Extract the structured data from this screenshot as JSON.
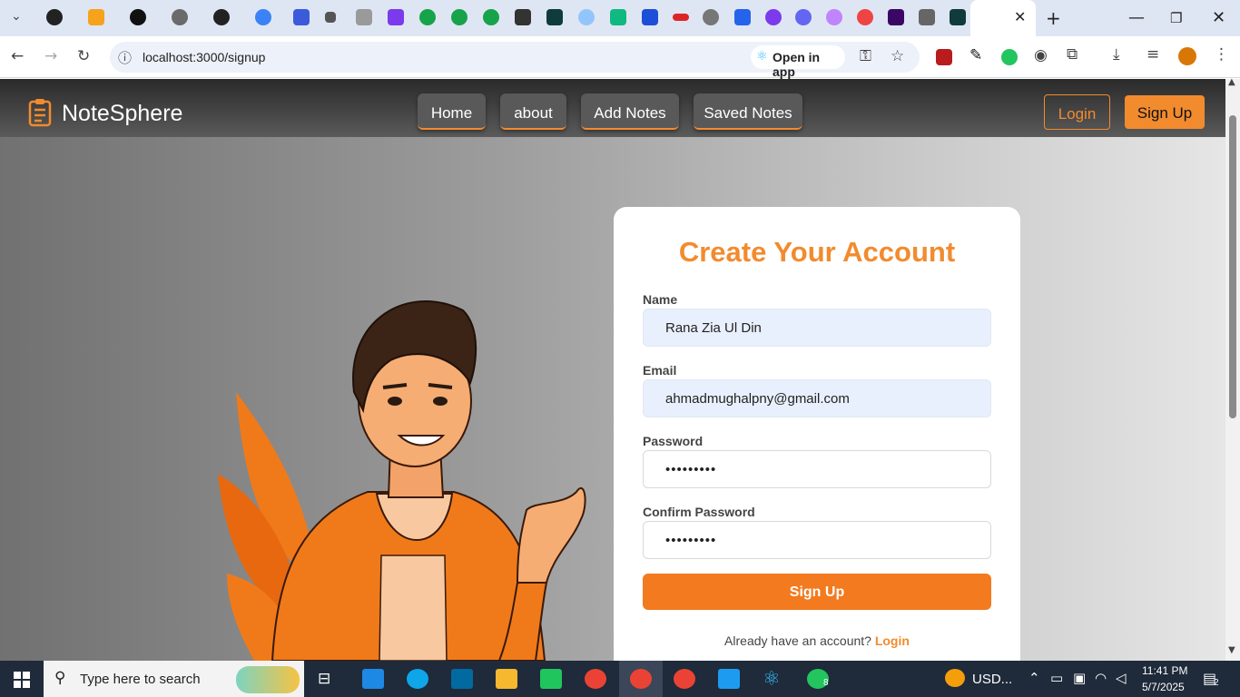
{
  "browser": {
    "url": "localhost:3000/signup",
    "open_in_app": "Open in app"
  },
  "nav": {
    "brand": "NoteSphere",
    "links": [
      "Home",
      "about",
      "Add Notes",
      "Saved Notes"
    ],
    "login": "Login",
    "signup": "Sign Up"
  },
  "form": {
    "title": "Create Your Account",
    "name_label": "Name",
    "name_value": "Rana Zia Ul Din",
    "email_label": "Email",
    "email_value": "ahmadmughalpny@gmail.com",
    "password_label": "Password",
    "password_value": "•••••••••",
    "confirm_label": "Confirm Password",
    "confirm_value": "•••••••••",
    "submit": "Sign Up",
    "already_text": "Already have an account?",
    "already_link": "Login"
  },
  "taskbar": {
    "search_placeholder": "Type here to search",
    "weather": "USD...",
    "time": "11:41 PM",
    "date": "5/7/2025",
    "whatsapp_badge": "8",
    "notification_count": "2"
  },
  "colors": {
    "accent": "#f28b2e",
    "button": "#f37a1f",
    "navbar": "#3a3a3a",
    "input_filled": "#e9f0fd"
  }
}
